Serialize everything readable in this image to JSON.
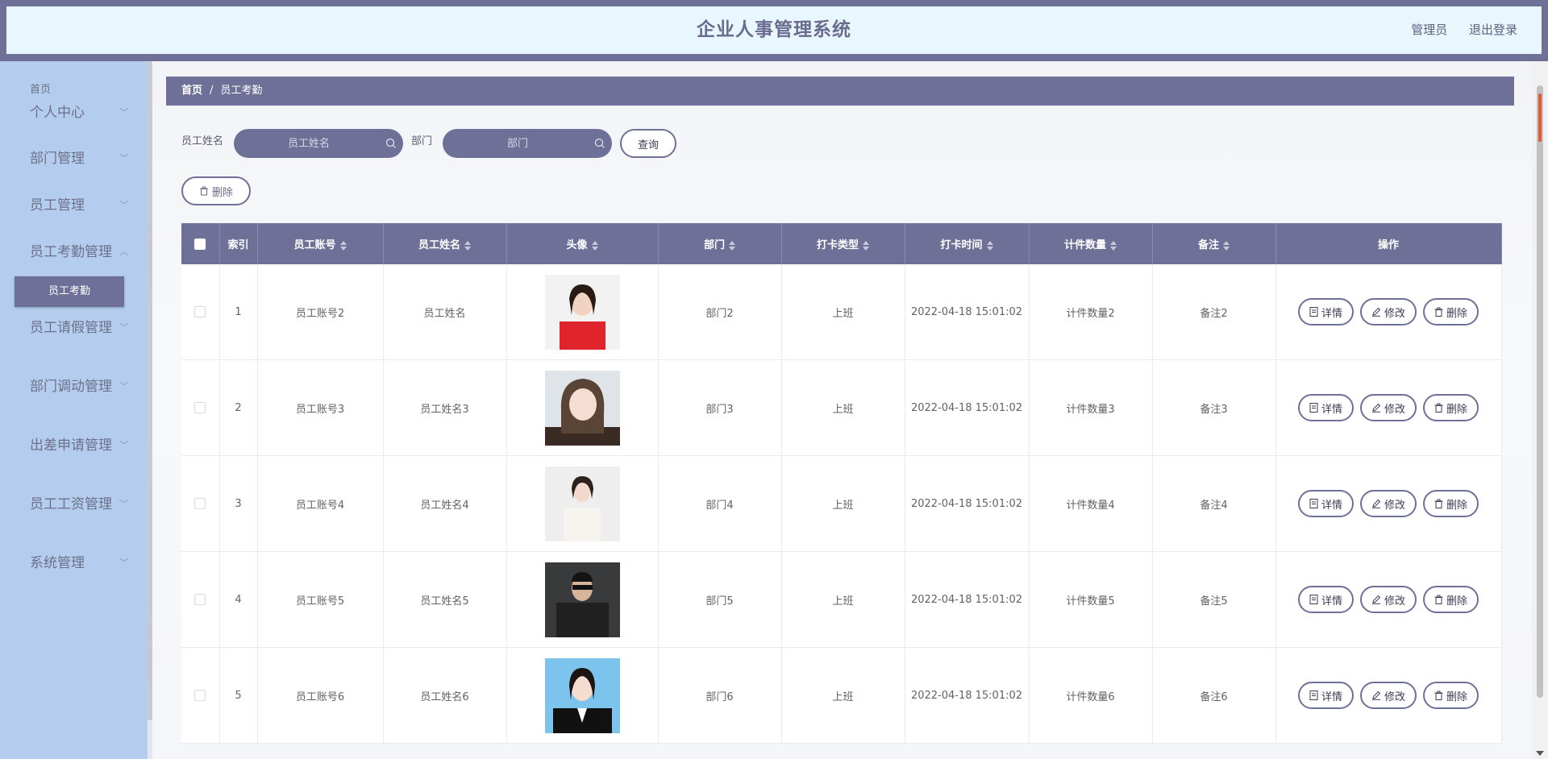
{
  "header": {
    "title": "企业人事管理系统",
    "user_label": "管理员",
    "logout_label": "退出登录"
  },
  "sidebar": {
    "home": "首页",
    "items": [
      {
        "label": "个人中心"
      },
      {
        "label": "部门管理"
      },
      {
        "label": "员工管理"
      },
      {
        "label": "员工考勤管理"
      },
      {
        "label": "员工请假管理"
      },
      {
        "label": "部门调动管理"
      },
      {
        "label": "出差申请管理"
      },
      {
        "label": "员工工资管理"
      },
      {
        "label": "系统管理"
      }
    ],
    "active_sub": "员工考勤"
  },
  "breadcrumb": {
    "home": "首页",
    "sep": "/",
    "current": "员工考勤"
  },
  "filters": {
    "name_label": "员工姓名",
    "name_placeholder": "员工姓名",
    "dept_label": "部门",
    "dept_placeholder": "部门",
    "query_label": "查询",
    "batch_delete_label": "删除"
  },
  "table": {
    "headers": {
      "index": "索引",
      "account": "员工账号",
      "name": "员工姓名",
      "avatar": "头像",
      "dept": "部门",
      "punch_type": "打卡类型",
      "punch_time": "打卡时间",
      "count": "计件数量",
      "remark": "备注",
      "ops": "操作"
    },
    "actions": {
      "detail": "详情",
      "edit": "修改",
      "delete": "删除"
    },
    "rows": [
      {
        "index": "1",
        "account": "员工账号2",
        "name": "员工姓名",
        "dept": "部门2",
        "punch_type": "上班",
        "punch_time": "2022-04-18 15:01:02",
        "count": "计件数量2",
        "remark": "备注2"
      },
      {
        "index": "2",
        "account": "员工账号3",
        "name": "员工姓名3",
        "dept": "部门3",
        "punch_type": "上班",
        "punch_time": "2022-04-18 15:01:02",
        "count": "计件数量3",
        "remark": "备注3"
      },
      {
        "index": "3",
        "account": "员工账号4",
        "name": "员工姓名4",
        "dept": "部门4",
        "punch_type": "上班",
        "punch_time": "2022-04-18 15:01:02",
        "count": "计件数量4",
        "remark": "备注4"
      },
      {
        "index": "4",
        "account": "员工账号5",
        "name": "员工姓名5",
        "dept": "部门5",
        "punch_type": "上班",
        "punch_time": "2022-04-18 15:01:02",
        "count": "计件数量5",
        "remark": "备注5"
      },
      {
        "index": "5",
        "account": "员工账号6",
        "name": "员工姓名6",
        "dept": "部门6",
        "punch_type": "上班",
        "punch_time": "2022-04-18 15:01:02",
        "count": "计件数量6",
        "remark": "备注6"
      }
    ]
  },
  "colors": {
    "primary": "#6f7097",
    "header_bg": "#e8f6fd",
    "sidebar_bg": "#b4cdee"
  }
}
